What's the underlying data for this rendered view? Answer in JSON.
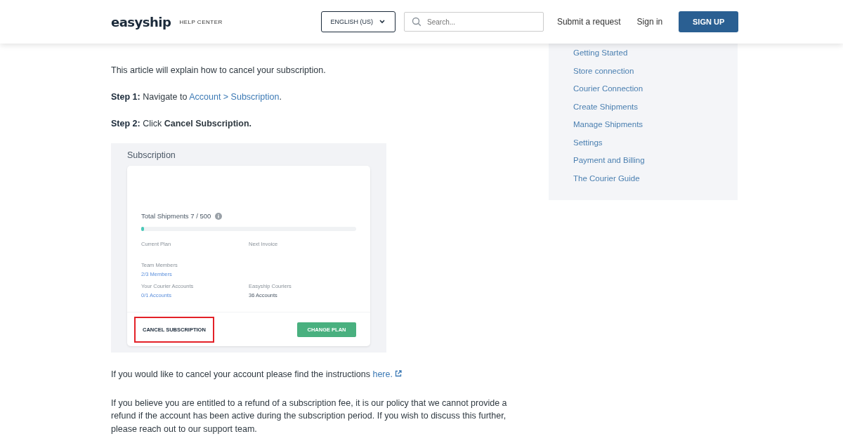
{
  "header": {
    "logo": "easyship",
    "subtitle": "HELP CENTER",
    "language": "ENGLISH (US)",
    "search": {
      "placeholder": "Search..."
    },
    "links": [
      "Submit a request",
      "Sign in"
    ],
    "signup": "SIGN UP"
  },
  "article": {
    "intro": "This article will explain how to cancel your subscription.",
    "steps": [
      {
        "label": "Step 1:",
        "text": "Navigate to",
        "link": "Account > Subscription",
        "after": "."
      },
      {
        "label": "Step 2:",
        "text": "Click **Cancel Subscription.**"
      }
    ],
    "screenshot": {
      "title": "Subscription",
      "total": "Total Shipments 7 / 500",
      "level": 0.014,
      "rows": [
        [
          {
            "label": "Current Plan"
          },
          {
            "label": "Next Invoice"
          }
        ],
        [
          {
            "label": "Team Members",
            "value": "2/3 Members",
            "link": true
          }
        ],
        [
          {
            "label": "Your Courier Accounts",
            "value": "0/1 Accounts",
            "link": true
          },
          {
            "label": "Easyship Couriers",
            "value": "36 Accounts",
            "link": false
          }
        ]
      ],
      "cancel": {
        "label": "CANCEL SUBSCRIPTION",
        "highlighted": true
      },
      "change": "CHANGE PLAN"
    },
    "paragraphs": [
      {
        "text": "If you would like to cancel your account please find the instructions",
        "link": "here."
      },
      {
        "text": "If you believe you are entitled to a refund of a subscription fee, it is our policy that we cannot provide a refund if the account has been active during the subscription period. If you wish to discuss this further, please reach out to our support team."
      }
    ]
  },
  "sidebar": {
    "items": [
      "Getting Started",
      "Store connection",
      "Courier Connection",
      "Create Shipments",
      "Manage Shipments",
      "Settings",
      "Payment and Billing",
      "The Courier Guide"
    ]
  }
}
